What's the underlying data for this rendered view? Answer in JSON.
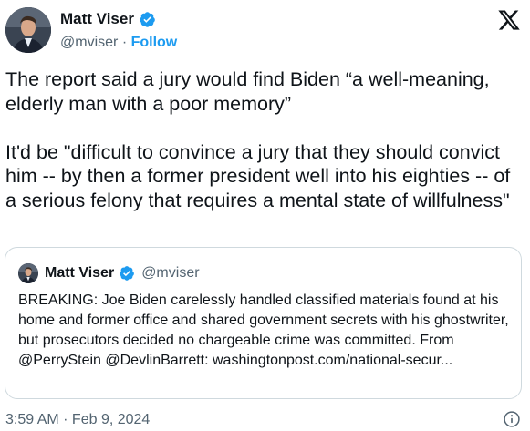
{
  "author": {
    "name": "Matt Viser",
    "handle": "@mviser",
    "separator": "·",
    "follow_label": "Follow"
  },
  "tweet": {
    "text": "The report said a jury would find Biden “a well-meaning, elderly man with a poor memory”\n\nIt'd be \"difficult to convince a jury that they should convict him -- by then a former president well into his eighties -- of a serious felony that requires a mental state of willfulness\""
  },
  "quoted": {
    "name": "Matt Viser",
    "handle": "@mviser",
    "text": "BREAKING: Joe Biden carelessly handled classified materials found at his home and former office and shared government secrets with his ghostwriter, but prosecutors decided no chargeable crime was committed. From @PerryStein @DevlinBarrett: washingtonpost.com/national-secur..."
  },
  "timestamp": "3:59 AM · Feb 9, 2024",
  "icons": {
    "verified": "verified-badge-icon",
    "logo": "x-logo-icon",
    "info": "info-icon"
  },
  "colors": {
    "accent": "#1d9bf0",
    "text": "#0f1419",
    "secondary": "#536471",
    "border": "#cfd9de"
  }
}
